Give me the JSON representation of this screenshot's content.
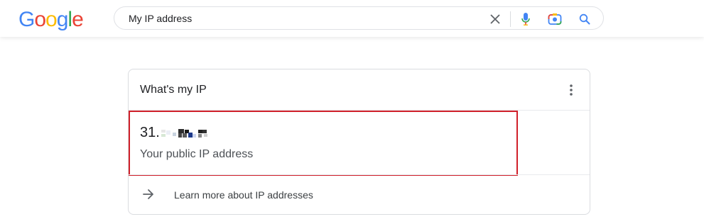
{
  "logo": {
    "letters": [
      "G",
      "o",
      "o",
      "g",
      "l",
      "e"
    ],
    "colors": [
      "#4285F4",
      "#EA4335",
      "#FBBC05",
      "#4285F4",
      "#34A853",
      "#EA4335"
    ]
  },
  "search": {
    "value": "My IP address"
  },
  "card": {
    "title": "What's my IP",
    "ip_visible_prefix": "31.",
    "ip_caption": "Your public IP address",
    "learn_more": "Learn more about IP addresses"
  },
  "colors": {
    "highlight": "#d0202a",
    "search_icon": "#4285F4",
    "mic_blue": "#4285F4",
    "mic_red": "#EA4335"
  },
  "icons": [
    "clear-icon",
    "mic-icon",
    "camera-lens-icon",
    "search-icon",
    "more-vert-icon",
    "arrow-right-icon"
  ]
}
